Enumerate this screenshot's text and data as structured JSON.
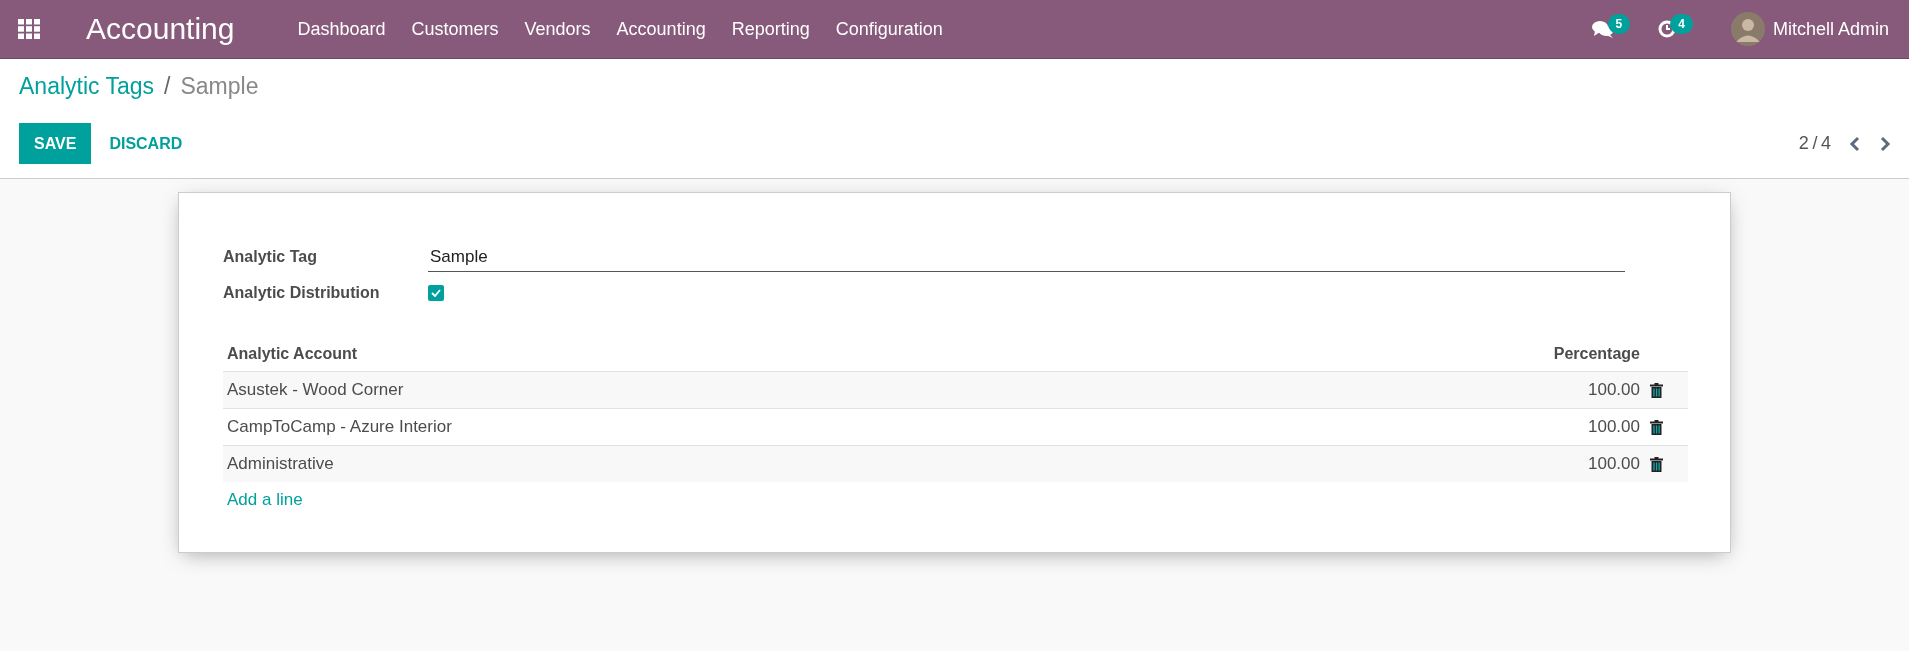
{
  "navbar": {
    "app_title": "Accounting",
    "menu": [
      "Dashboard",
      "Customers",
      "Vendors",
      "Accounting",
      "Reporting",
      "Configuration"
    ],
    "messages_count": "5",
    "activities_count": "4",
    "user_name": "Mitchell Admin"
  },
  "breadcrumb": [
    "Analytic Tags",
    "Sample"
  ],
  "breadcrumb_separator": "/",
  "buttons": [
    "SAVE",
    "DISCARD"
  ],
  "pager": "2 / 4",
  "form": {
    "fields": [
      {
        "kind": "text",
        "label": "Analytic Tag",
        "value": "Sample"
      },
      {
        "kind": "checkbox",
        "label": "Analytic Distribution",
        "checked": true
      }
    ],
    "table": {
      "columns": [
        "Analytic Account",
        "Percentage"
      ],
      "rows": [
        {
          "account": "Asustek - Wood Corner",
          "percentage": "100.00"
        },
        {
          "account": "CampToCamp - Azure Interior",
          "percentage": "100.00"
        },
        {
          "account": "Administrative",
          "percentage": "100.00"
        }
      ],
      "add_line": "Add a line"
    }
  }
}
